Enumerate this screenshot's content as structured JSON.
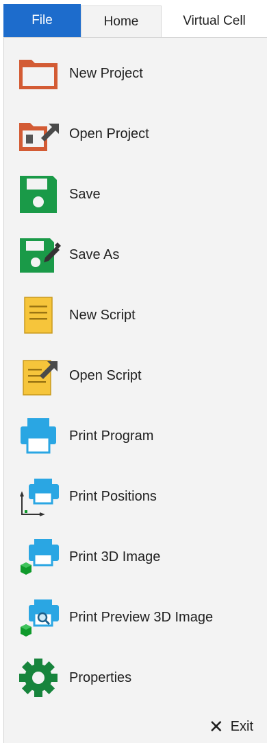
{
  "tabs": {
    "file": "File",
    "home": "Home",
    "virtual_cell": "Virtual Cell"
  },
  "menu": {
    "items": [
      {
        "label": "New Project",
        "icon": "new-project-icon"
      },
      {
        "label": "Open Project",
        "icon": "open-project-icon"
      },
      {
        "label": "Save",
        "icon": "save-icon"
      },
      {
        "label": "Save As",
        "icon": "save-as-icon"
      },
      {
        "label": "New Script",
        "icon": "new-script-icon"
      },
      {
        "label": "Open Script",
        "icon": "open-script-icon"
      },
      {
        "label": "Print Program",
        "icon": "print-program-icon"
      },
      {
        "label": "Print Positions",
        "icon": "print-positions-icon"
      },
      {
        "label": "Print 3D Image",
        "icon": "print-3d-image-icon"
      },
      {
        "label": "Print Preview 3D Image",
        "icon": "print-preview-3d-image-icon"
      },
      {
        "label": "Properties",
        "icon": "gear-icon"
      }
    ],
    "exit_label": "Exit"
  },
  "colors": {
    "file_tab": "#1d6ccc",
    "project_orange": "#d35b34",
    "save_green": "#1a9a48",
    "script_yellow": "#f6c53b",
    "printer_blue": "#2aa6e3",
    "cube_green": "#0f9a2b",
    "gear_green": "#17843c"
  }
}
